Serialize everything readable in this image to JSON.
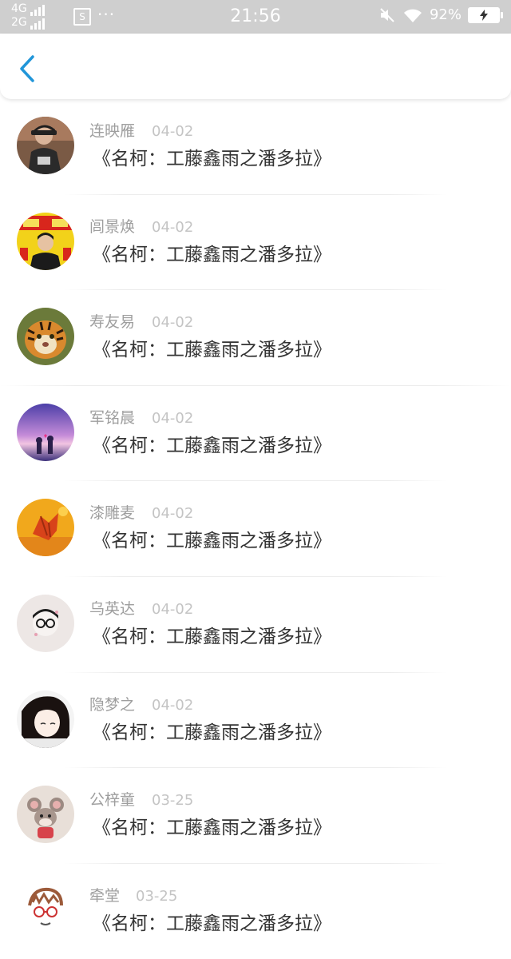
{
  "status_bar": {
    "network_top": "4G",
    "network_bottom": "2G",
    "sim_label": "S",
    "more_dots": "···",
    "time": "21:56",
    "battery_percent": "92%",
    "icons": [
      "signal-4g-icon",
      "signal-2g-icon",
      "sim-icon",
      "mute-icon",
      "wifi-icon",
      "battery-charging-icon"
    ]
  },
  "nav": {
    "back_icon": "chevron-left-icon",
    "accent": "#2196d9"
  },
  "list": {
    "items": [
      {
        "name": "连映雁",
        "date": "04-02",
        "title": "《名柯：工藤鑫雨之潘多拉》",
        "avatar": "person-cap"
      },
      {
        "name": "闾景焕",
        "date": "04-02",
        "title": "《名柯：工藤鑫雨之潘多拉》",
        "avatar": "person-yellow"
      },
      {
        "name": "寿友易",
        "date": "04-02",
        "title": "《名柯：工藤鑫雨之潘多拉》",
        "avatar": "tiger"
      },
      {
        "name": "军铭晨",
        "date": "04-02",
        "title": "《名柯：工藤鑫雨之潘多拉》",
        "avatar": "purple-sunset"
      },
      {
        "name": "漆雕麦",
        "date": "04-02",
        "title": "《名柯：工藤鑫雨之潘多拉》",
        "avatar": "orange-leaf"
      },
      {
        "name": "乌英达",
        "date": "04-02",
        "title": "《名柯：工藤鑫雨之潘多拉》",
        "avatar": "cartoon-glasses"
      },
      {
        "name": "隐梦之",
        "date": "04-02",
        "title": "《名柯：工藤鑫雨之潘多拉》",
        "avatar": "anime-girl"
      },
      {
        "name": "公梓童",
        "date": "03-25",
        "title": "《名柯：工藤鑫雨之潘多拉》",
        "avatar": "cartoon-mouse"
      },
      {
        "name": "牵堂",
        "date": "03-25",
        "title": "《名柯：工藤鑫雨之潘多拉》",
        "avatar": "sketch-glasses"
      }
    ]
  }
}
